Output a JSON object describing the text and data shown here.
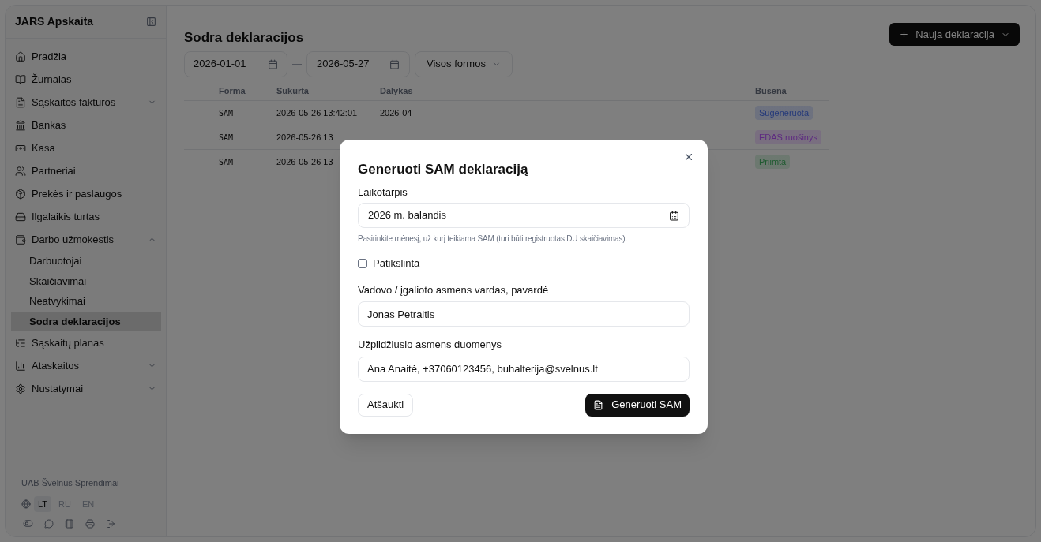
{
  "sidebar": {
    "title": "JARS Apskaita",
    "items": [
      {
        "label": "Pradžia",
        "selected": false
      },
      {
        "label": "Žurnalas",
        "selected": false
      },
      {
        "label": "Sąskaitos faktūros",
        "selected": false,
        "expanded": false
      },
      {
        "label": "Bankas",
        "selected": false
      },
      {
        "label": "Kasa",
        "selected": false
      },
      {
        "label": "Partneriai",
        "selected": false
      },
      {
        "label": "Prekės ir paslaugos",
        "selected": false
      },
      {
        "label": "Ilgalaikis turtas",
        "selected": false
      },
      {
        "label": "Darbo užmokestis",
        "selected": false,
        "expanded": true,
        "children": [
          {
            "label": "Darbuotojai",
            "selected": false
          },
          {
            "label": "Skaičiavimai",
            "selected": false
          },
          {
            "label": "Neatvykimai",
            "selected": false
          },
          {
            "label": "Sodra deklaracijos",
            "selected": true
          }
        ]
      },
      {
        "label": "Sąskaitų planas",
        "selected": false
      },
      {
        "label": "Ataskaitos",
        "selected": false,
        "expanded": false
      },
      {
        "label": "Nustatymai",
        "selected": false,
        "expanded": false
      }
    ],
    "company": "UAB Švelnūs Sprendimai",
    "languages": [
      {
        "label": "LT",
        "selected": true
      },
      {
        "label": "RU",
        "selected": false
      },
      {
        "label": "EN",
        "selected": false
      }
    ]
  },
  "page": {
    "title": "Sodra deklaracijos",
    "new_button": "Nauja deklaracija",
    "date_from": "2026-01-01",
    "date_to": "2026-05-27",
    "date_separator": "—",
    "form_filter": "Visos formos"
  },
  "table": {
    "columns": [
      "Forma",
      "Sukurta",
      "Dalykas",
      "Būsena"
    ],
    "rows": [
      {
        "form": "SAM",
        "created": "2026-05-26 13:42:01",
        "subject": "2026-04",
        "status": "Sugeneruota",
        "color": "#24397a"
      },
      {
        "form": "SAM",
        "created": "2026-05-26 13",
        "status": "EDAS ruošinys",
        "color": "#5e2a80"
      },
      {
        "form": "SAM",
        "created": "2026-05-26 13",
        "status": "Priimta",
        "color": "#1f5a30"
      }
    ]
  },
  "dialog": {
    "title": "Generuoti SAM deklaraciją",
    "period_label": "Laikotarpis",
    "period_value": "2026 m. balandis",
    "period_hint": "Pasirinkite mėnesį, už kurį teikiama SAM (turi būti registruotas DU skaičiavimas).",
    "corrected": {
      "label": "Patikslinta",
      "checked": false
    },
    "manager_label": "Vadovo / įgalioto asmens vardas, pavardė",
    "manager_value": "Jonas Petraitis",
    "filler_label": "Užpildžiusio asmens duomenys",
    "filler_value": "Ana Anaitė, +37060123456, buhalterija@svelnus.lt",
    "cancel": "Atšaukti",
    "submit": "Generuoti SAM"
  }
}
